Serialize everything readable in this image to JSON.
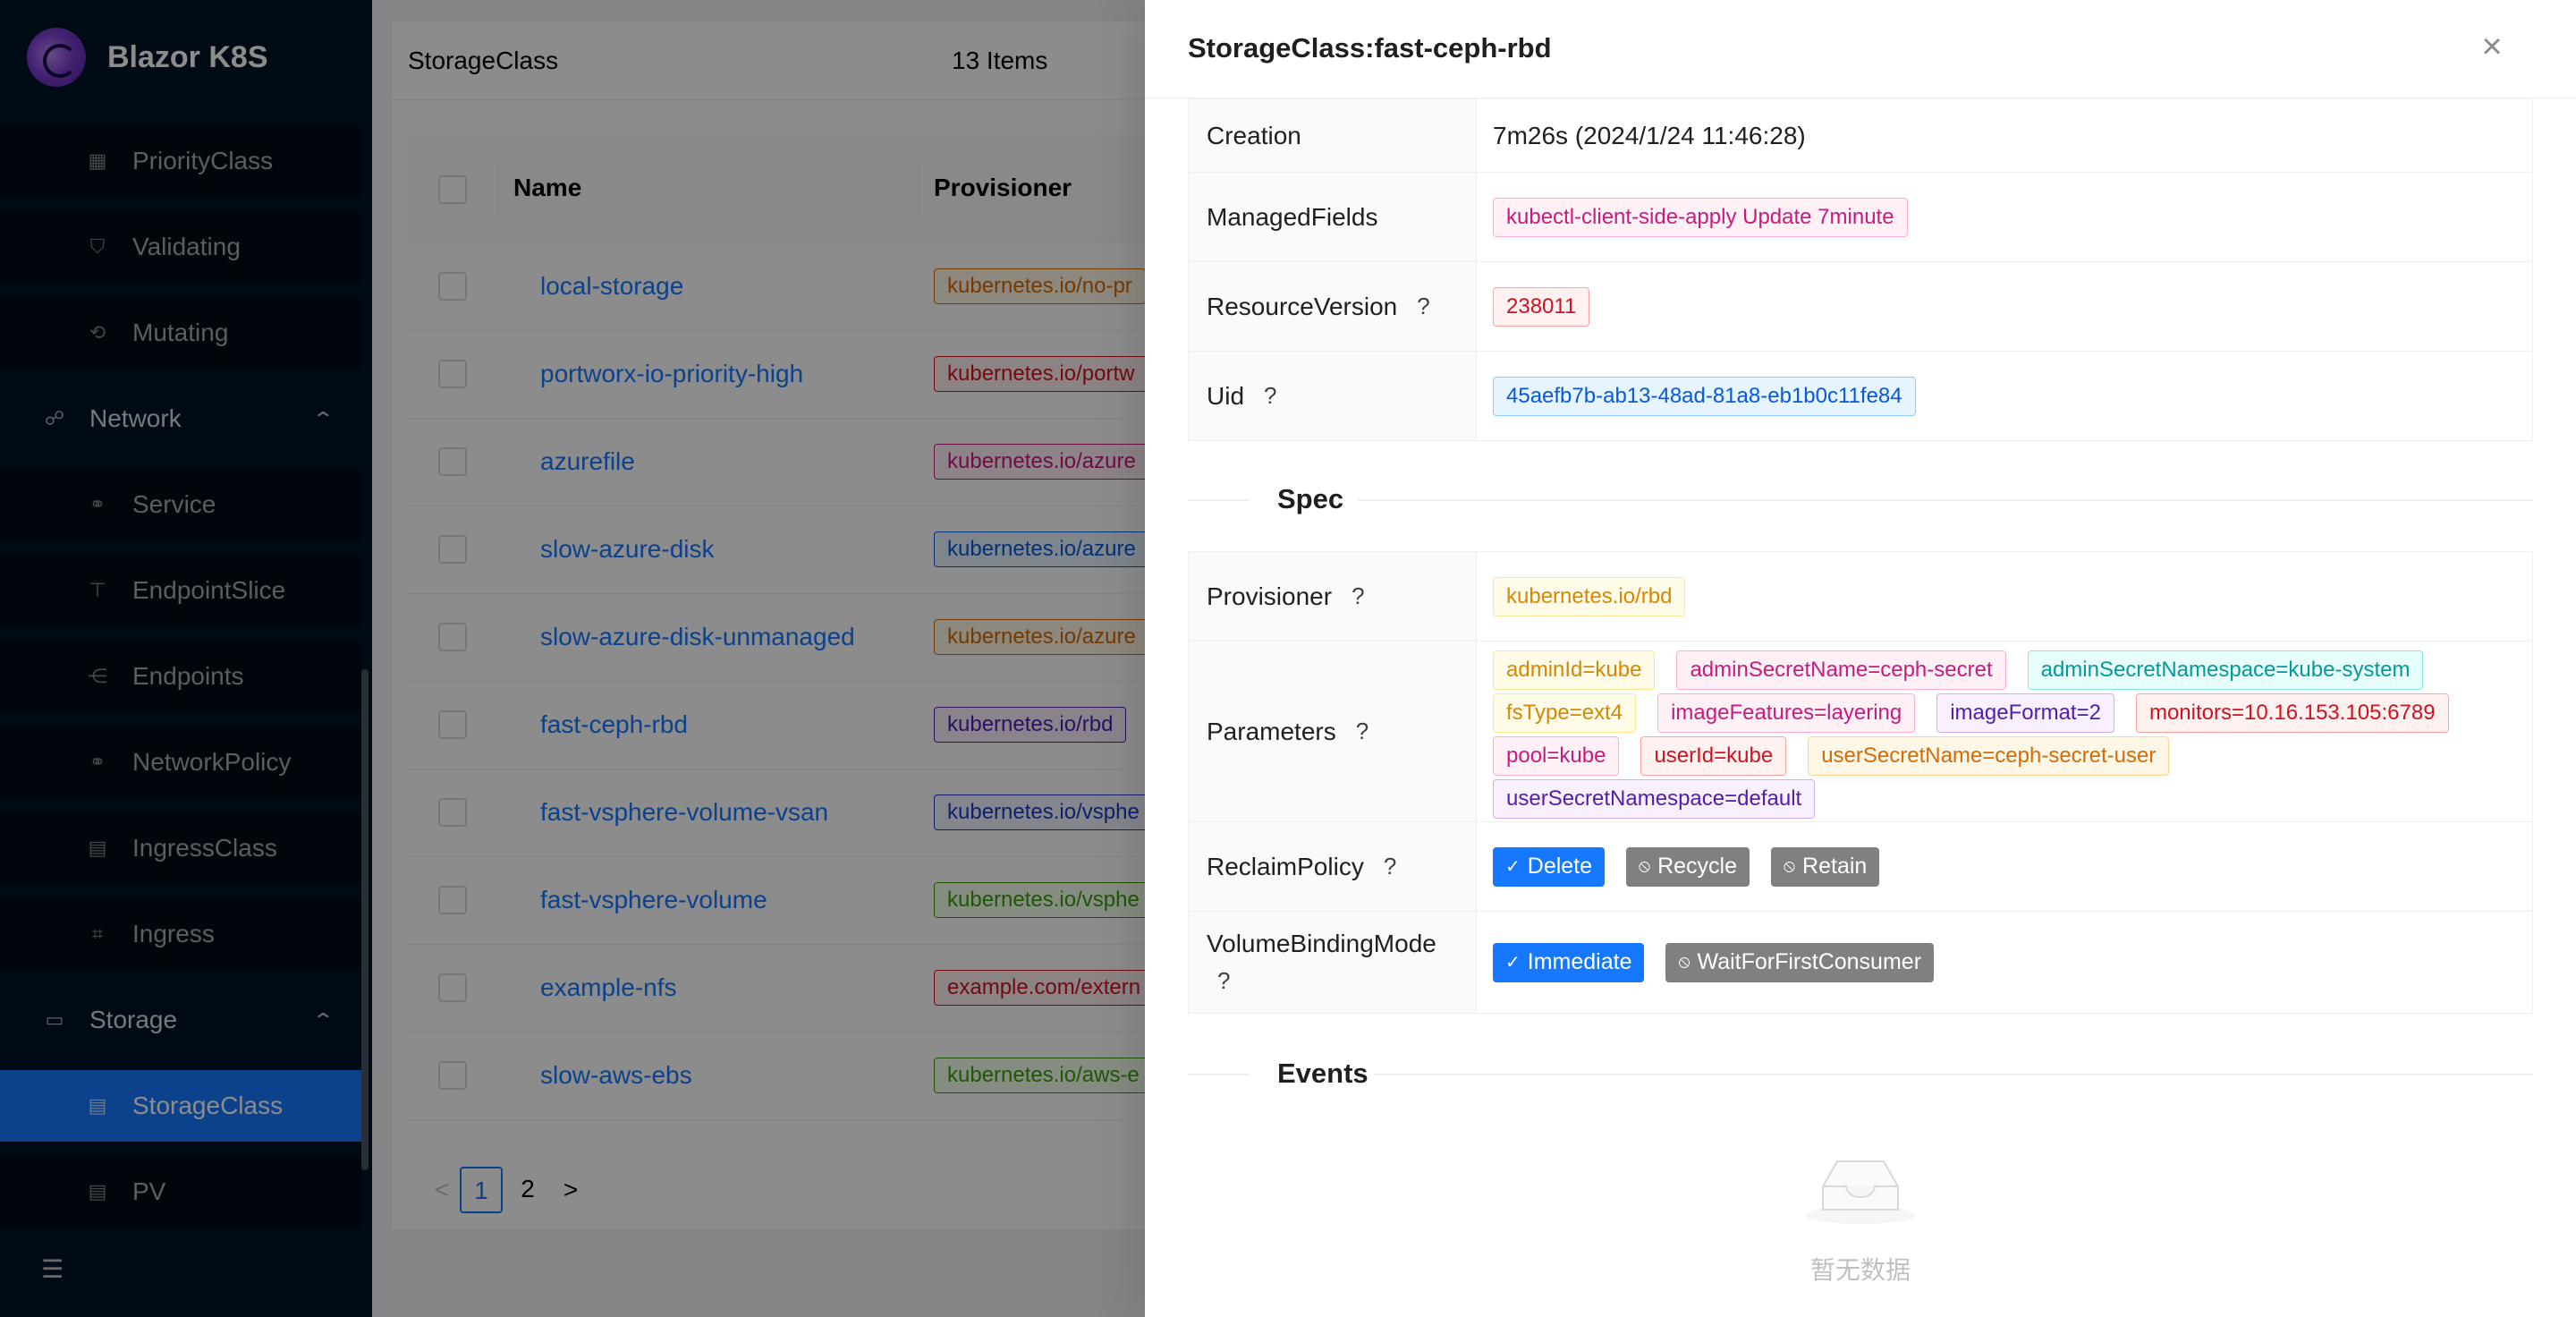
{
  "app": {
    "title": "Blazor K8S"
  },
  "sidebar": {
    "items": [
      {
        "label": "PriorityClass",
        "icon": "table-icon",
        "type": "sub"
      },
      {
        "label": "Validating",
        "icon": "shield-icon",
        "type": "sub"
      },
      {
        "label": "Mutating",
        "icon": "mutate-icon",
        "type": "sub"
      },
      {
        "label": "Network",
        "icon": "cluster-icon",
        "type": "group",
        "expanded": true
      },
      {
        "label": "Service",
        "icon": "nodes-icon",
        "type": "sub"
      },
      {
        "label": "EndpointSlice",
        "icon": "slice-icon",
        "type": "sub"
      },
      {
        "label": "Endpoints",
        "icon": "endpoints-icon",
        "type": "sub"
      },
      {
        "label": "NetworkPolicy",
        "icon": "nodes-icon",
        "type": "sub"
      },
      {
        "label": "IngressClass",
        "icon": "ingressclass-icon",
        "type": "sub"
      },
      {
        "label": "Ingress",
        "icon": "ingress-icon",
        "type": "sub"
      },
      {
        "label": "Storage",
        "icon": "storage-icon",
        "type": "group",
        "expanded": true
      },
      {
        "label": "StorageClass",
        "icon": "file-icon",
        "type": "sub",
        "active": true
      },
      {
        "label": "PV",
        "icon": "file-icon",
        "type": "sub"
      }
    ]
  },
  "list": {
    "title": "StorageClass",
    "count": "13 Items",
    "columns": {
      "name": "Name",
      "provisioner": "Provisioner"
    },
    "rows": [
      {
        "name": "local-storage",
        "provisioner": "kubernetes.io/no-pr",
        "color": "orange"
      },
      {
        "name": "portworx-io-priority-high",
        "provisioner": "kubernetes.io/portw",
        "color": "red"
      },
      {
        "name": "azurefile",
        "provisioner": "kubernetes.io/azure",
        "color": "magenta"
      },
      {
        "name": "slow-azure-disk",
        "provisioner": "kubernetes.io/azure",
        "color": "blue"
      },
      {
        "name": "slow-azure-disk-unmanaged",
        "provisioner": "kubernetes.io/azure",
        "color": "orange"
      },
      {
        "name": "fast-ceph-rbd",
        "provisioner": "kubernetes.io/rbd",
        "color": "purple"
      },
      {
        "name": "fast-vsphere-volume-vsan",
        "provisioner": "kubernetes.io/vsphe",
        "color": "geekblue"
      },
      {
        "name": "fast-vsphere-volume",
        "provisioner": "kubernetes.io/vsphe",
        "color": "green"
      },
      {
        "name": "example-nfs",
        "provisioner": "example.com/extern",
        "color": "red"
      },
      {
        "name": "slow-aws-ebs",
        "provisioner": "kubernetes.io/aws-e",
        "color": "green"
      }
    ],
    "pagination": {
      "prev": "<",
      "pages": [
        "1",
        "2"
      ],
      "current": "1",
      "next": ">"
    }
  },
  "drawer": {
    "title": "StorageClass:fast-ceph-rbd",
    "close_icon": "close-icon",
    "metadata": [
      {
        "label": "Creation",
        "value": "7m26s (2024/1/24 11:46:28)",
        "help": false
      },
      {
        "label": "ManagedFields",
        "tag": "kubectl-client-side-apply Update 7minute",
        "color": "magenta",
        "help": false
      },
      {
        "label": "ResourceVersion",
        "tag": "238011",
        "color": "red",
        "help": true
      },
      {
        "label": "Uid",
        "tag": "45aefb7b-ab13-48ad-81a8-eb1b0c11fe84",
        "color": "blue",
        "help": true
      }
    ],
    "help_mark": "?",
    "spec_title": "Spec",
    "spec": {
      "provisioner_label": "Provisioner",
      "provisioner_tag": {
        "text": "kubernetes.io/rbd",
        "color": "gold"
      },
      "parameters_label": "Parameters",
      "parameters": [
        {
          "text": "adminId=kube",
          "color": "gold"
        },
        {
          "text": "adminSecretName=ceph-secret",
          "color": "magenta"
        },
        {
          "text": "adminSecretNamespace=kube-system",
          "color": "cyan"
        },
        {
          "text": "fsType=ext4",
          "color": "gold"
        },
        {
          "text": "imageFeatures=layering",
          "color": "magenta"
        },
        {
          "text": "imageFormat=2",
          "color": "purple"
        },
        {
          "text": "monitors=10.16.153.105:6789",
          "color": "red"
        },
        {
          "text": "pool=kube",
          "color": "magenta"
        },
        {
          "text": "userId=kube",
          "color": "red"
        },
        {
          "text": "userSecretName=ceph-secret-user",
          "color": "orange"
        },
        {
          "text": "userSecretNamespace=default",
          "color": "purple"
        }
      ],
      "reclaim_label": "ReclaimPolicy",
      "reclaim_options": [
        {
          "text": "Delete",
          "selected": true
        },
        {
          "text": "Recycle",
          "selected": false
        },
        {
          "text": "Retain",
          "selected": false
        }
      ],
      "binding_label": "VolumeBindingMode",
      "binding_options": [
        {
          "text": "Immediate",
          "selected": true
        },
        {
          "text": "WaitForFirstConsumer",
          "selected": false
        }
      ]
    },
    "events_title": "Events",
    "events_empty": "暂无数据"
  }
}
